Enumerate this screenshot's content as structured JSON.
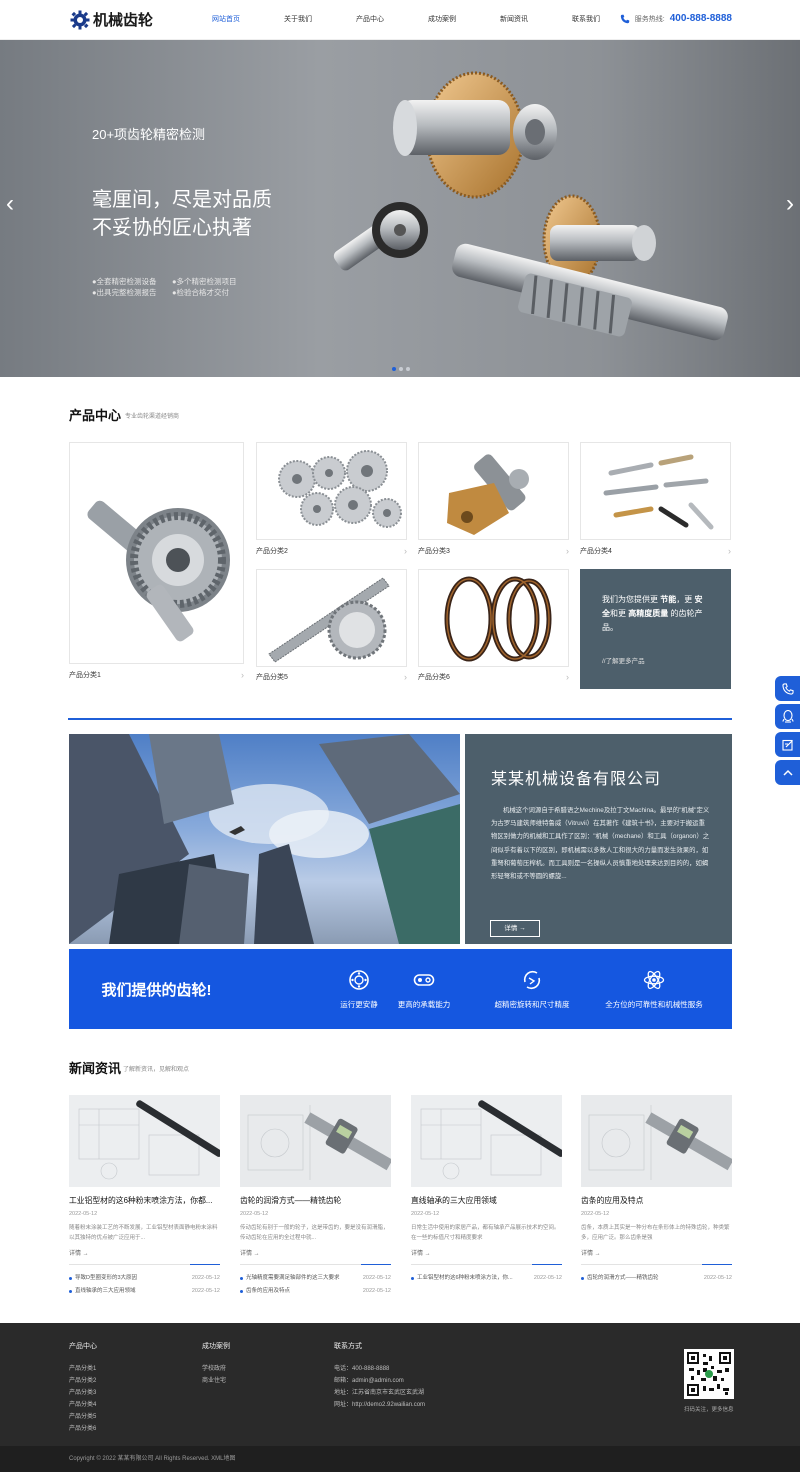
{
  "brand": {
    "logo_text": "机械齿轮",
    "accent": "#1f5fd8"
  },
  "nav": {
    "items": [
      "网站首页",
      "关于我们",
      "产品中心",
      "成功案例",
      "新闻资讯",
      "联系我们"
    ],
    "active_index": 0,
    "hotline_label": "服务热线:",
    "hotline_number": "400-888-8888"
  },
  "banner": {
    "small_title": "20+项齿轮精密检测",
    "big_line1": "毫厘间，尽是对品质",
    "big_line2": "不妥协的匠心执著",
    "features": [
      "●全套精密检测设备",
      "●多个精密检测项目",
      "●出具完整检测报告",
      "●检验合格才交付"
    ],
    "prev": "‹",
    "next": "›"
  },
  "products": {
    "title": "产品中心",
    "subtitle": "专业齿轮渠道经销商",
    "items": [
      {
        "name": "产品分类1"
      },
      {
        "name": "产品分类2"
      },
      {
        "name": "产品分类3"
      },
      {
        "name": "产品分类4"
      },
      {
        "name": "产品分类5"
      },
      {
        "name": "产品分类6"
      }
    ],
    "promo": {
      "text_parts": [
        "我们为您提供更 ",
        "节能",
        "，更 ",
        "安全",
        "和更 ",
        "高精度质量",
        " 的齿轮产品。"
      ],
      "more": "//了解更多产品"
    }
  },
  "about": {
    "title": "某某机械设备有限公司",
    "body": "机械这个词源自于希腊语之Mechine及拉丁文Machina。最早的\"机械\"定义为古罗马建筑师维特鲁威（Vitruvii）在其著作《建筑十书》，主要对于搬运重物区别做力的机械和工具作了区别：\"机械（mechane）和工具（organon）之间似乎有着以下的区别，即机械需以多数人工和很大的力量而发生效果的，如重弩和葡萄压榨机。而工具则是一名操纵人员慎重地处理来达到目的的，如蝎形轻弩和或不等圆的螺旋...",
    "button": "详情 →"
  },
  "features": {
    "title": "我们提供的齿轮!",
    "items": [
      {
        "label": "运行更安静",
        "icon": "bearing-icon"
      },
      {
        "label": "更高的承载能力",
        "icon": "chain-link-icon"
      },
      {
        "label": "超精密旋转和尺寸精度",
        "icon": "precision-rotate-icon"
      },
      {
        "label": "全方位的可靠性和机械性服务",
        "icon": "atom-icon"
      }
    ]
  },
  "news": {
    "title": "新闻资讯",
    "subtitle": "了解新资讯，见解和观点",
    "more": "详情 →",
    "cards": [
      {
        "title": "工业铝型材的这6种粉末喷涂方法，你都...",
        "date": "2022-05-12",
        "summary": "随着粉末涂装工艺的不断发展，工业铝型材表面静电粉末涂料以其独特的优点被广泛应用于...",
        "img": "pen",
        "links": [
          {
            "t": "导致D型圈变形的3大原因",
            "d": "2022-05-12"
          },
          {
            "t": "直线轴承的三大应用领域",
            "d": "2022-05-12"
          }
        ]
      },
      {
        "title": "齿轮的润滑方式——精铣齿轮",
        "date": "2022-05-12",
        "summary": "传动齿轮有别于一般的轮子，这是带齿的，要是没有润滑脂，传动齿轮在应用的全过程中就...",
        "img": "caliper",
        "links": [
          {
            "t": "光轴精度需要满足轴部件的这三大要求",
            "d": "2022-05-12"
          },
          {
            "t": "齿条的应用及特点",
            "d": "2022-05-12"
          }
        ]
      },
      {
        "title": "直线轴承的三大应用领域",
        "date": "2022-05-12",
        "summary": "日常生活中使用的家居产品，都有轴承产品展示技术的空间。在一些的标值尺寸和精度要求",
        "img": "pen",
        "links": [
          {
            "t": "工业铝型材的这6种粉末喷涂方法，你...",
            "d": "2022-05-12"
          }
        ]
      },
      {
        "title": "齿条的应用及特点",
        "date": "2022-05-12",
        "summary": "齿条，本质上其实是一种分布在条形体上的特殊齿轮，种类繁多，应用广泛。那么齿条是强",
        "img": "caliper",
        "links": [
          {
            "t": "齿轮的润滑方式——精铣齿轮",
            "d": "2022-05-12"
          }
        ]
      }
    ]
  },
  "footer": {
    "col1": {
      "title": "产品中心",
      "items": [
        "产品分类1",
        "产品分类2",
        "产品分类3",
        "产品分类4",
        "产品分类5",
        "产品分类6"
      ]
    },
    "col2": {
      "title": "成功案例",
      "items": [
        "学校政府",
        "商业住宅"
      ]
    },
    "col3": {
      "title": "联系方式",
      "items": [
        "电话：400-888-8888",
        "邮箱：admin@admin.com",
        "地址：江苏省南京市玄武区玄武湖",
        "网址：http://demo2.92wailian.com"
      ]
    },
    "qr_caption": "扫码关注，更多信息",
    "copyright": "Copyright © 2022 某某有限公司 All Rights Reserved. XML地图"
  }
}
